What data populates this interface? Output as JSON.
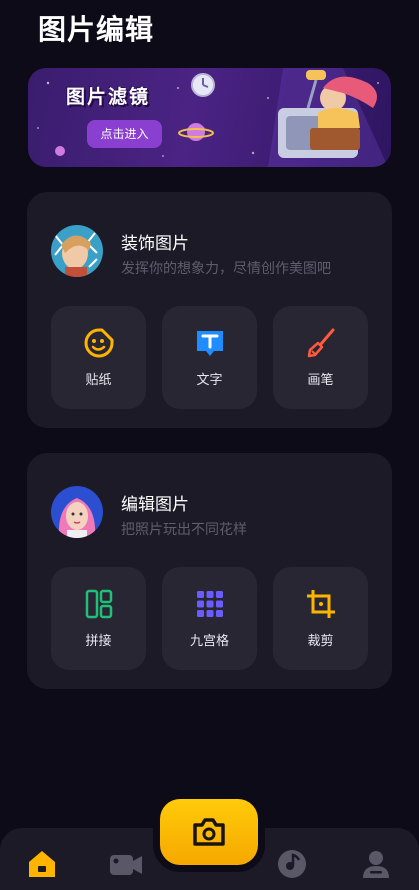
{
  "header": {
    "title": "图片编辑"
  },
  "banner": {
    "title": "图片滤镜",
    "button_label": "点击进入"
  },
  "decorate": {
    "title": "装饰图片",
    "subtitle": "发挥你的想象力，尽情创作美图吧",
    "tools": [
      {
        "label": "贴纸",
        "icon": "sticker-icon",
        "color": "#ffb400"
      },
      {
        "label": "文字",
        "icon": "text-icon",
        "color": "#1f8cff"
      },
      {
        "label": "画笔",
        "icon": "brush-icon",
        "color": "#ff5a3c"
      }
    ]
  },
  "edit": {
    "title": "编辑图片",
    "subtitle": "把照片玩出不同花样",
    "tools": [
      {
        "label": "拼接",
        "icon": "collage-icon",
        "color": "#20c07a"
      },
      {
        "label": "九宫格",
        "icon": "grid-icon",
        "color": "#6a5cff"
      },
      {
        "label": "裁剪",
        "icon": "crop-icon",
        "color": "#ffb400"
      }
    ]
  },
  "bottom_nav": {
    "items": [
      {
        "icon": "home-icon",
        "active": true
      },
      {
        "icon": "video-camera-icon",
        "active": false
      },
      {
        "icon": "camera-icon",
        "active": false
      },
      {
        "icon": "music-disc-icon",
        "active": false
      },
      {
        "icon": "user-icon",
        "active": false
      }
    ],
    "active_color": "#ffb400",
    "inactive_color": "#5a5866"
  }
}
